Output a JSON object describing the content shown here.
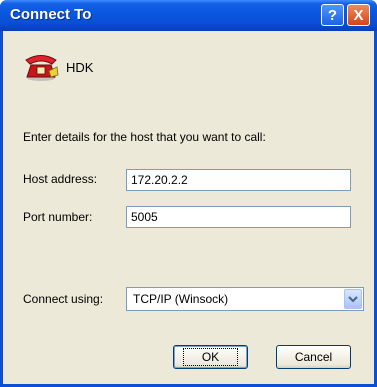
{
  "window": {
    "title": "Connect To"
  },
  "titlebar": {
    "help_label": "?",
    "close_label": "X"
  },
  "connection": {
    "name": "HDK",
    "icon": "telephone-icon"
  },
  "form": {
    "instructions": "Enter details for the host that you want to call:",
    "host_label": "Host address:",
    "host_value": "172.20.2.2",
    "port_label": "Port number:",
    "port_value": "5005",
    "connect_label": "Connect using:",
    "connect_value": "TCP/IP (Winsock)"
  },
  "buttons": {
    "ok_label": "OK",
    "cancel_label": "Cancel"
  },
  "colors": {
    "titlebar": "#0a4fd6",
    "face": "#ece9d8",
    "input_border": "#7f9db9"
  }
}
